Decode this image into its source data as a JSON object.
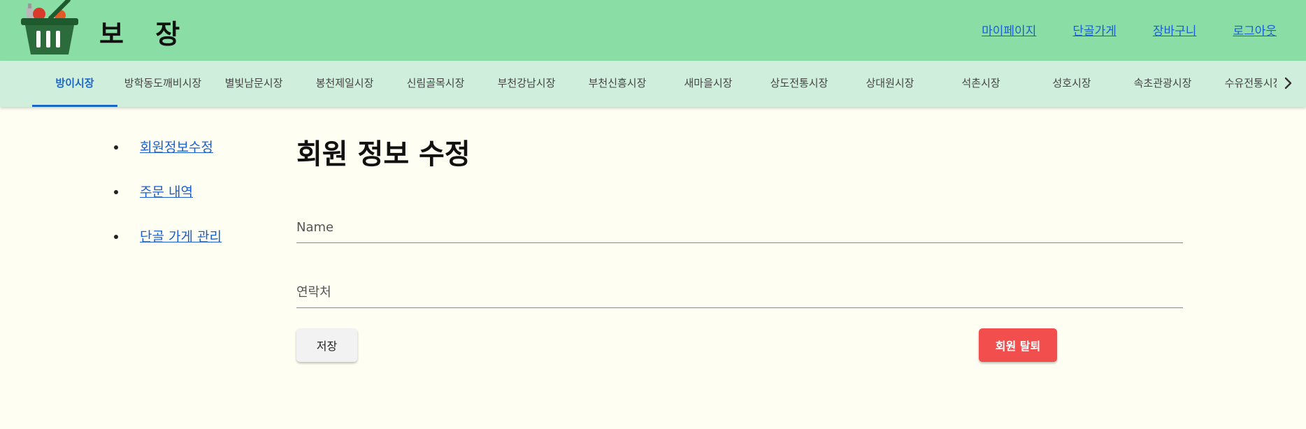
{
  "brand": {
    "title": "보 장",
    "logo_icon": "shopping-basket-icon"
  },
  "header": {
    "links": [
      "마이페이지",
      "단골가게",
      "장바구니",
      "로그아웃"
    ]
  },
  "markets": {
    "tabs": [
      "방이시장",
      "방학동도깨비시장",
      "별빛남문시장",
      "봉천제일시장",
      "신림골목시장",
      "부천강남시장",
      "부천신흥시장",
      "새마을시장",
      "상도전통시장",
      "상대원시장",
      "석촌시장",
      "성호시장",
      "속초관광시장",
      "수유전통시장"
    ],
    "active_index": 0,
    "scroll_icon": "chevron-right-icon"
  },
  "sidebar": {
    "items": [
      "회원정보수정",
      "주문 내역",
      "단골 가게 관리"
    ]
  },
  "form": {
    "title": "회원 정보 수정",
    "name_placeholder": "Name",
    "phone_placeholder": "연락처",
    "save_label": "저장",
    "withdraw_label": "회원 탈퇴"
  },
  "colors": {
    "header_bg": "#8adea5",
    "tabbar_bg": "#cfeedb",
    "page_bg": "#fffef2",
    "link": "#1a5fd0",
    "active_tab": "#1a66c9",
    "danger": "#f24e4e"
  }
}
